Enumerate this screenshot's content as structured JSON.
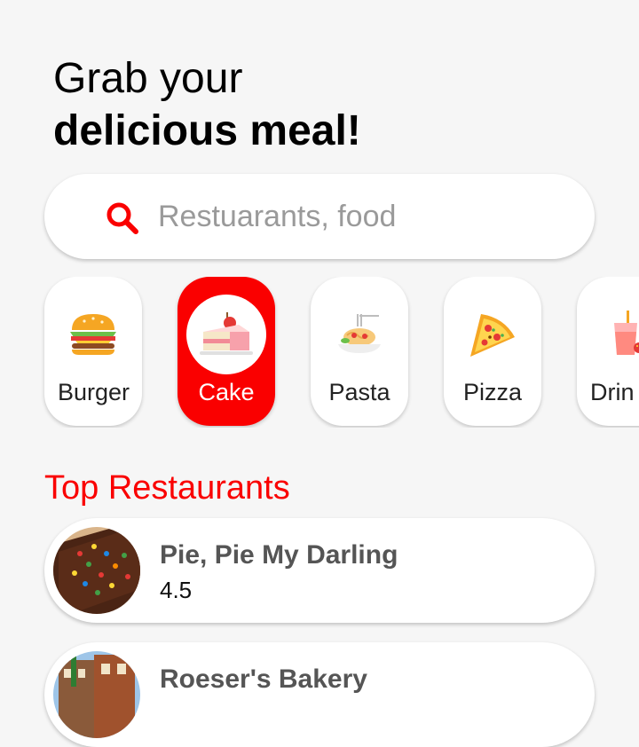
{
  "header": {
    "line1": "Grab your",
    "line2": "delicious meal!"
  },
  "search": {
    "placeholder": "Restuarants, food",
    "value": "",
    "icon": "search-icon"
  },
  "categories": [
    {
      "label": "Burger",
      "icon": "burger-icon",
      "selected": false
    },
    {
      "label": "Cake",
      "icon": "cake-icon",
      "selected": true
    },
    {
      "label": "Pasta",
      "icon": "pasta-icon",
      "selected": false
    },
    {
      "label": "Pizza",
      "icon": "pizza-icon",
      "selected": false
    },
    {
      "label": "Drin",
      "icon": "drink-icon",
      "selected": false
    }
  ],
  "section": {
    "title": "Top Restaurants"
  },
  "restaurants": [
    {
      "name": "Pie, Pie My Darling",
      "rating": "4.5"
    },
    {
      "name": "Roeser's Bakery",
      "rating": ""
    }
  ],
  "colors": {
    "accent": "#fa0000",
    "background": "#f6f6f6",
    "card": "#ffffff"
  }
}
